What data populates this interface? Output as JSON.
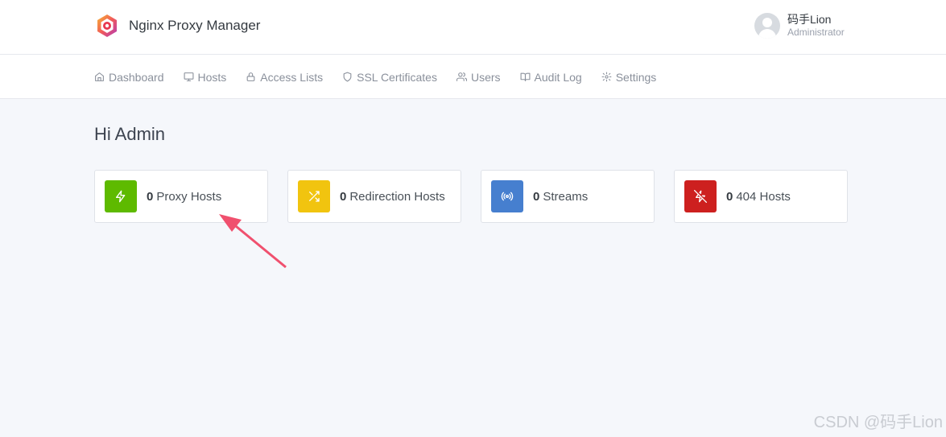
{
  "app": {
    "title": "Nginx Proxy Manager"
  },
  "user": {
    "name": "码手Lion",
    "role": "Administrator"
  },
  "nav": [
    {
      "label": "Dashboard",
      "icon": "home-icon"
    },
    {
      "label": "Hosts",
      "icon": "monitor-icon"
    },
    {
      "label": "Access Lists",
      "icon": "lock-icon"
    },
    {
      "label": "SSL Certificates",
      "icon": "shield-icon"
    },
    {
      "label": "Users",
      "icon": "users-icon"
    },
    {
      "label": "Audit Log",
      "icon": "book-icon"
    },
    {
      "label": "Settings",
      "icon": "gear-icon"
    }
  ],
  "greeting": "Hi Admin",
  "cards": [
    {
      "count": "0",
      "label": "Proxy Hosts",
      "color": "#5eba00",
      "icon": "zap-icon"
    },
    {
      "count": "0",
      "label": "Redirection Hosts",
      "color": "#f1c40f",
      "icon": "shuffle-icon"
    },
    {
      "count": "0",
      "label": "Streams",
      "color": "#467fcf",
      "icon": "radio-icon"
    },
    {
      "count": "0",
      "label": "404 Hosts",
      "color": "#cd201f",
      "icon": "zap-off-icon"
    }
  ],
  "annotation": {
    "color": "#f0506e"
  },
  "watermark": "CSDN @码手Lion"
}
